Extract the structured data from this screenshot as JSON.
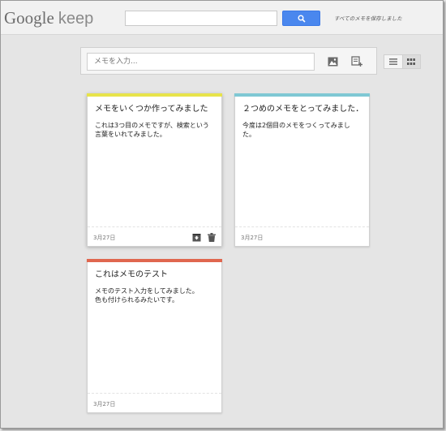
{
  "header": {
    "logo_google": "Google",
    "logo_keep": "keep",
    "search_placeholder": "",
    "search_link": "すべてのメモを保存しました"
  },
  "compose": {
    "placeholder": "メモを入力...",
    "image_icon": "image-icon",
    "list_icon": "list-add-icon"
  },
  "view_toggle": {
    "list_icon": "list-view-icon",
    "grid_icon": "grid-view-icon",
    "active": "grid"
  },
  "notes": [
    {
      "title": "メモをいくつか作ってみました",
      "body": "これは3つ目のメモですが、検索という言葉をいれてみました。",
      "date": "3月27日",
      "color": "#e7e34a"
    },
    {
      "title": "２つめのメモをとってみました．",
      "body": "今度は2個目のメモをつくってみました。",
      "date": "3月27日",
      "color": "#7fc8d4"
    },
    {
      "title": "これはメモのテスト",
      "body_line1": "メモのテスト入力をしてみました。",
      "body_line2": "色も付けられるみたいです。",
      "date": "3月27日",
      "color": "#e0674f"
    }
  ],
  "colors": {
    "accent": "#4a87ee",
    "background": "#e5e5e5"
  }
}
